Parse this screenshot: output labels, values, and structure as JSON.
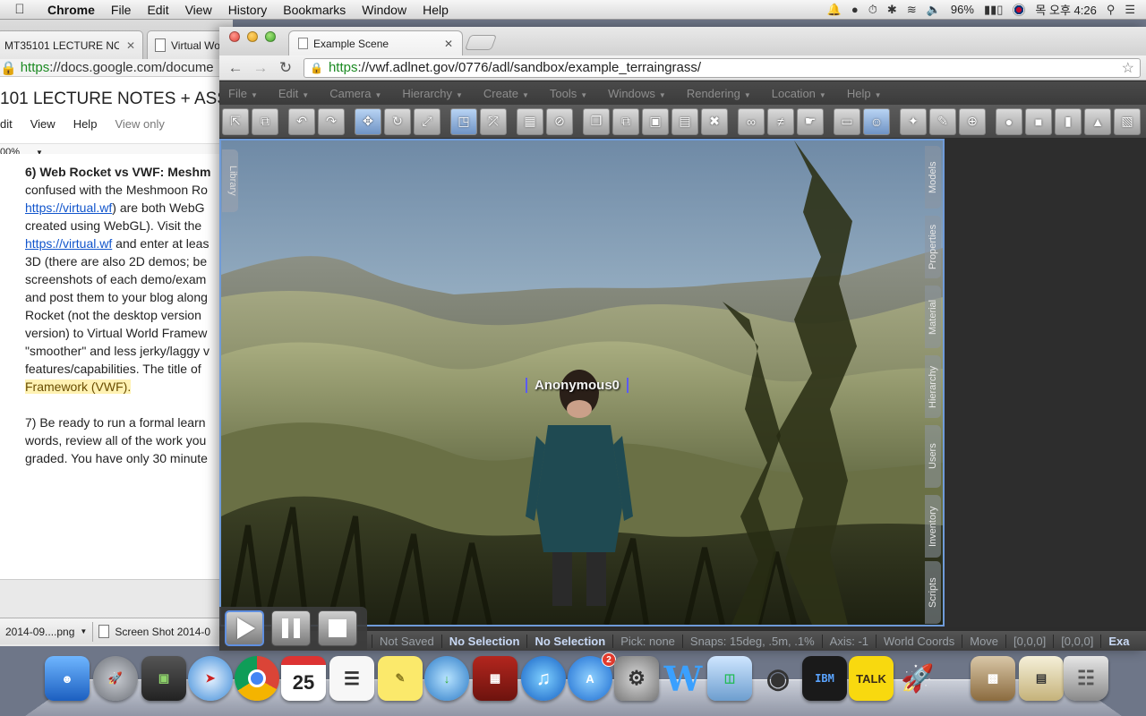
{
  "menubar": {
    "app": "Chrome",
    "items": [
      "File",
      "Edit",
      "View",
      "History",
      "Bookmarks",
      "Window",
      "Help"
    ],
    "battery": "96%",
    "clock": "목 오후 4:26"
  },
  "docs_window": {
    "tab1": "MT35101 LECTURE NOTES",
    "tab2": "Virtual Wo",
    "url_https": "https",
    "url_rest": "://docs.google.com/docume",
    "doc_title": "101 LECTURE NOTES + ASSI",
    "menu": [
      "dit",
      "View",
      "Help"
    ],
    "view_only": "View only",
    "zoom": "00%",
    "body_lines": [
      {
        "text": "6) Web Rocket vs VWF: Meshm"
      },
      {
        "text": "confused with the Meshmoon Ro"
      },
      {
        "link": "https://virtual.wf",
        "text": ") are both WebG"
      },
      {
        "text": "created using WebGL). Visit the"
      },
      {
        "link": "https://virtual.wf",
        "text": " and enter at leas"
      },
      {
        "text": "3D (there are also 2D demos; be"
      },
      {
        "text": "screenshots of each demo/exam"
      },
      {
        "text": "and post them to your blog along"
      },
      {
        "text": "Rocket (not the desktop version"
      },
      {
        "text": "version) to Virtual World Framew"
      },
      {
        "text": "\"smoother\" and less jerky/laggy v"
      },
      {
        "text": "features/capabilities. The title of"
      },
      {
        "highlight": "Framework (VWF)."
      },
      {
        "text": ""
      },
      {
        "text": "7) Be ready to run a formal learn"
      },
      {
        "text": "words, review all of the work you"
      },
      {
        "text": "graded. You have only 30 minute"
      }
    ]
  },
  "download_bar": {
    "item1": "2014-09....png",
    "item2": "Screen Shot 2014-0"
  },
  "chrome": {
    "tab_title": "Example Scene",
    "url_https": "https",
    "url_rest": "://vwf.adlnet.gov/0776/adl/sandbox/example_terraingrass/"
  },
  "sandbox": {
    "menus": [
      "File",
      "Edit",
      "Camera",
      "Hierarchy",
      "Create",
      "Tools",
      "Windows",
      "Rendering",
      "Location",
      "Help"
    ],
    "side_tabs": [
      "Models",
      "Properties",
      "Material",
      "Hierarchy",
      "Users",
      "Inventory",
      "Scripts"
    ],
    "library_tab": "Library",
    "avatar_name": "Anonymous0",
    "status": [
      "Not Saved",
      "No Selection",
      "No Selection",
      "Pick: none",
      "Snaps: 15deg, .5m, .1%",
      "Axis: -1",
      "World Coords",
      "Move",
      "[0,0,0]",
      "[0,0,0]",
      "Exa"
    ]
  },
  "dock": {
    "calendar_day": "25",
    "appstore_badge": "2",
    "ibm_label": "IBM",
    "talk_label": "TALK"
  }
}
